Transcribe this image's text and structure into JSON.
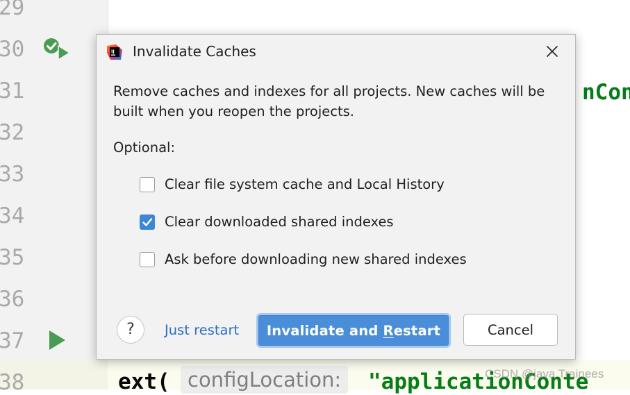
{
  "editor": {
    "line_numbers": [
      "29",
      "30",
      "31",
      "32",
      "33",
      "34",
      "35",
      "36",
      "37",
      "38"
    ],
    "code_fragment_right": "nCont",
    "code_line_38_prefix": "ext(",
    "param_hint": "configLocation:",
    "code_line_38_string": "\"applicationConte",
    "watermark": "CSDN @java Trainees"
  },
  "dialog": {
    "title": "Invalidate Caches",
    "app_icon": "intellij-idea-icon",
    "message": "Remove caches and indexes for all projects. New caches will be built when you reopen the projects.",
    "optional_label": "Optional:",
    "options": [
      {
        "label": "Clear file system cache and Local History",
        "checked": false
      },
      {
        "label": "Clear downloaded shared indexes",
        "checked": true
      },
      {
        "label": "Ask before downloading new shared indexes",
        "checked": false
      }
    ],
    "help_label": "?",
    "just_restart_label": "Just restart",
    "invalidate_restart": {
      "before": "Invalidate and ",
      "mnemonic": "R",
      "after": "estart"
    },
    "cancel_label": "Cancel"
  },
  "colors": {
    "accent": "#3d84d6",
    "link": "#2a6fc2",
    "run_icon_green": "#499c54",
    "string_green": "#067d17"
  }
}
